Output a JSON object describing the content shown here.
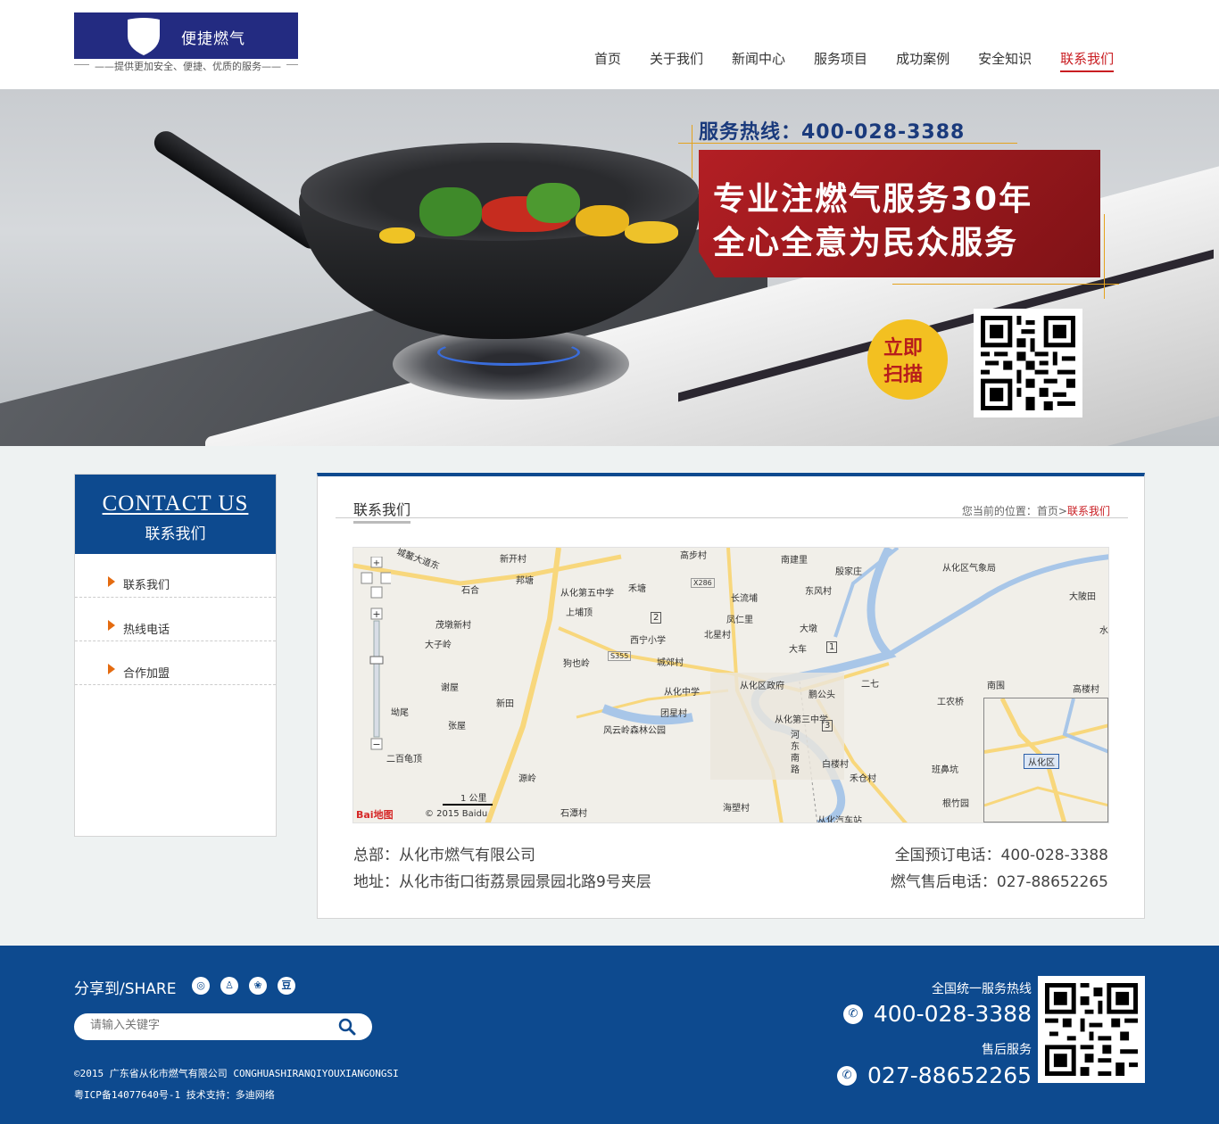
{
  "header": {
    "brand": "便捷燃气",
    "slogan": "——提供更加安全、便捷、优质的服务——",
    "nav": [
      {
        "label": "首页"
      },
      {
        "label": "关于我们"
      },
      {
        "label": "新闻中心"
      },
      {
        "label": "服务项目"
      },
      {
        "label": "成功案例"
      },
      {
        "label": "安全知识"
      },
      {
        "label": "联系我们"
      }
    ]
  },
  "banner": {
    "hotline": "服务热线：400-028-3388",
    "slogan_line1": "专业注燃气服务30年",
    "slogan_line2": "全心全意为民众服务",
    "scan_line1": "立即",
    "scan_line2": "扫描"
  },
  "sidebar": {
    "title_en": "CONTACT US",
    "title_cn": "联系我们",
    "items": [
      {
        "label": "联系我们"
      },
      {
        "label": "热线电话"
      },
      {
        "label": "合作加盟"
      }
    ]
  },
  "content": {
    "title": "联系我们",
    "breadcrumb_prefix": "您当前的位置：首页>",
    "breadcrumb_current": "联系我们",
    "map": {
      "labels": [
        "城鳌大道东",
        "新开村",
        "高步村",
        "南建里",
        "殷家庄",
        "从化区气象局",
        "石合",
        "邦塘",
        "从化第五中学",
        "禾塘",
        "X286",
        "长流埔",
        "东风村",
        "大陂田",
        "上埔顶",
        "凤仁里",
        "茂墩新村",
        "2",
        "西宁小学",
        "北星村",
        "大墩",
        "大子岭",
        "S355",
        "狗也岭",
        "城郊村",
        "大车",
        "1",
        "从化区政府",
        "谢屋",
        "从化中学",
        "二七",
        "鹏公头",
        "南围",
        "高楼村",
        "工农桥",
        "坳尾",
        "新田",
        "团星村",
        "从化第三中学",
        "张屋",
        "风云岭森林公园",
        "3",
        "河东南路",
        "白楼村",
        "禾仓村",
        "班鼻坑",
        "二百龟顶",
        "源岭",
        "海塑村",
        "根竹园",
        "石潭村",
        "从化汽车站",
        "1 公里",
        "© 2015 Baidu",
        "从化区",
        "水"
      ],
      "logo": "Bai地图"
    },
    "hq": "总部：从化市燃气有限公司",
    "address": "地址：从化市街口街荔景园景园北路9号夹层",
    "booking_phone": "全国预订电话：400-028-3388",
    "aftersale_phone": "燃气售后电话：027-88652265"
  },
  "footer": {
    "share_label": "分享到/SHARE",
    "share_icons": [
      "weibo-icon",
      "qq-icon",
      "baidu-icon",
      "douban-icon"
    ],
    "search_placeholder": "请输入关键字",
    "copyright": "©2015  广东省从化市燃气有限公司  CONGHUASHIRANQIYOUXIANGONGSI",
    "icp": "粤ICP备14077640号-1  技术支持：多迪网络",
    "hotline_label": "全国统一服务热线",
    "hotline": "400-028-3388",
    "aftersale_label": "售后服务",
    "aftersale": "027-88652265"
  },
  "colors": {
    "brand_blue": "#0d4a8f",
    "logo_blue": "#232b81",
    "active_red": "#c91d22",
    "accent_orange": "#e46b10"
  }
}
